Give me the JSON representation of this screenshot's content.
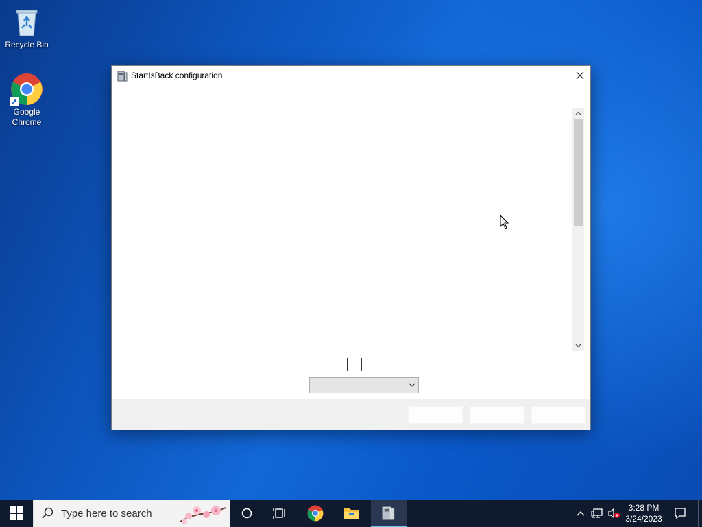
{
  "desktop": {
    "icons": [
      {
        "label": "Recycle Bin",
        "icon": "recycle-bin-icon"
      },
      {
        "label": "Google\nChrome",
        "icon": "chrome-icon"
      }
    ]
  },
  "window": {
    "title": "StartIsBack configuration",
    "icon": "app-icon",
    "close_icon": "close-icon",
    "dropdown": {
      "selected": ""
    },
    "buttons": [
      "",
      "",
      ""
    ]
  },
  "taskbar": {
    "start_icon": "windows-logo-icon",
    "search_placeholder": "Type here to search",
    "pinned": [
      "cortana-icon",
      "task-view-icon",
      "chrome-icon",
      "file-explorer-icon",
      "startisback-config-icon"
    ],
    "tray": {
      "time": "3:28 PM",
      "date": "3/24/2023"
    }
  },
  "colors": {
    "accent": "#76b9ed",
    "taskbar": "#101a2e"
  }
}
